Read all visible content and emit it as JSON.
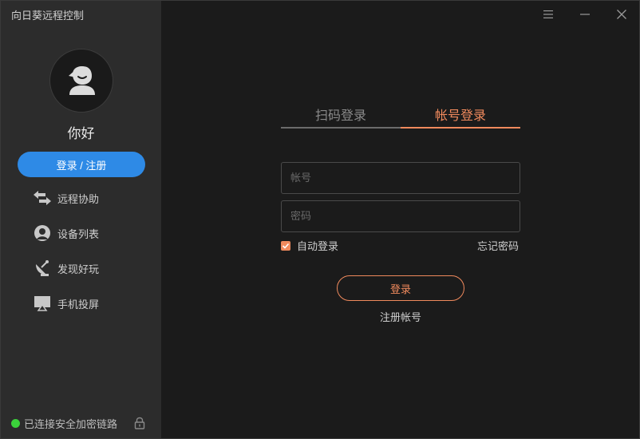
{
  "app": {
    "title": "向日葵远程控制"
  },
  "sidebar": {
    "greeting": "你好",
    "login_register_label": "登录 / 注册",
    "items": [
      {
        "label": "远程协助",
        "icon": "remote-assist-icon"
      },
      {
        "label": "设备列表",
        "icon": "device-list-icon"
      },
      {
        "label": "发现好玩",
        "icon": "discover-icon"
      },
      {
        "label": "手机投屏",
        "icon": "screen-cast-icon"
      }
    ],
    "status_text": "已连接安全加密链路",
    "status_color": "#3bd33b"
  },
  "window_controls": [
    "menu-icon",
    "minimize-icon",
    "close-icon"
  ],
  "main": {
    "tabs": [
      {
        "label": "扫码登录",
        "active": false
      },
      {
        "label": "帐号登录",
        "active": true
      }
    ],
    "account_placeholder": "帐号",
    "password_placeholder": "密码",
    "auto_login_label": "自动登录",
    "auto_login_checked": true,
    "forgot_password_label": "忘记密码",
    "login_button_label": "登录",
    "register_link_label": "注册帐号"
  },
  "colors": {
    "accent": "#f08a5d",
    "primary": "#2e8ae6",
    "sidebar_bg": "#2c2c2c",
    "main_bg": "#1b1b1b"
  }
}
